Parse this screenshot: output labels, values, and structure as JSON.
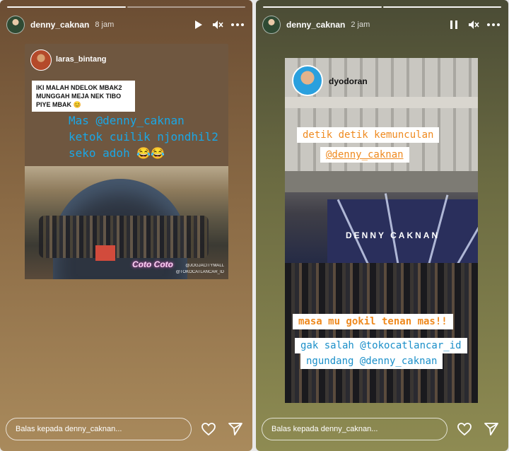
{
  "left_story": {
    "username": "denny_caknan",
    "time": "8 jam",
    "progress_segments": 2,
    "progress_done": 1,
    "reply_placeholder": "Balas kepada denny_caknan...",
    "repost": {
      "username": "laras_bintang",
      "note": "IKI MALAH NDELOK MBAK2 MUNGGAH MEJA NEK TIBO PIYE MBAK 😊",
      "caption_lines": [
        "Mas @denny_caknan",
        "ketok cuilik njondhil2",
        "seko adoh 😂😂"
      ],
      "photo_sign": "Coto Coto",
      "watermark_1": "@JOGJACITYMALL",
      "watermark_2": "@TOKOCATLANCAR_ID"
    }
  },
  "right_story": {
    "username": "denny_caknan",
    "time": "2 jam",
    "progress_segments": 2,
    "progress_done": 2,
    "reply_placeholder": "Balas kepada denny_caknan...",
    "repost": {
      "username": "dyodoran",
      "headline_1": "detik detik kemunculan",
      "headline_2": "@denny_caknan",
      "stage_text": "DENNY CAKNAN",
      "caption_orange": "masa mu gokil tenan mas!!",
      "caption_blue_1": "gak salah @tokocatlancar_id",
      "caption_blue_2": "ngundang @denny_caknan"
    }
  },
  "icons": {
    "play": "play-icon",
    "pause": "pause-icon",
    "mute": "mute-icon",
    "more": "more-icon",
    "like": "heart-icon",
    "share": "send-icon"
  },
  "colors": {
    "caption_blue": "#1aa7e6",
    "caption_orange": "#ef8a1f"
  }
}
